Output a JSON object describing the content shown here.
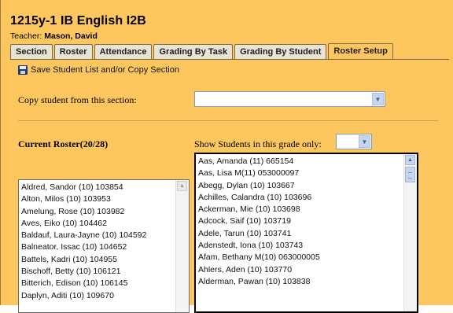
{
  "header": {
    "title": "1215y-1 IB English I2B",
    "teacher_label": "Teacher:",
    "teacher_name": "Mason, David"
  },
  "tabs": [
    {
      "label": "Section"
    },
    {
      "label": "Roster"
    },
    {
      "label": "Attendance"
    },
    {
      "label": "Grading By Task"
    },
    {
      "label": "Grading By Student"
    },
    {
      "label": "Roster Setup",
      "active": true
    }
  ],
  "toolbar": {
    "save_label": "Save Student List and/or Copy Section"
  },
  "copy_section": {
    "label": "Copy student from this section:",
    "selected_value": ""
  },
  "current_roster": {
    "label": "Current Roster(20/28)",
    "items": [
      "Aldred, Sandor (10) 103854",
      "Alton, Milos (10) 103953",
      "Amelung, Rose (10) 103982",
      "Aves, Eiko (10) 104462",
      "Baldauf, Laura-Jayne (10) 104592",
      "Balneator, Issac (10) 104652",
      "Battels, Kadri (10) 104955",
      "Bischoff, Betty (10) 106121",
      "Bitterich, Edison (10) 106145",
      "Daplyn, Aditi (10) 109670"
    ]
  },
  "grade_filter": {
    "label": "Show Students in this grade only:",
    "selected_value": ""
  },
  "students": {
    "items": [
      "Aas, Amanda (11) 665154",
      "Aas, Lisa M(11) 053000097",
      "Abegg, Dylan (10) 103667",
      "Achilles, Calandra (10) 103696",
      "Ackerman, Mie (10) 103698",
      "Adcock, Saif (10) 103719",
      "Adele, Tarun (10) 103741",
      "Adenstedt, Iona (10) 103743",
      "Afam, Bethany M(10) 063000005",
      "Ahlers, Aden (10) 103770",
      "Alderman, Pawan (10) 103838"
    ]
  }
}
